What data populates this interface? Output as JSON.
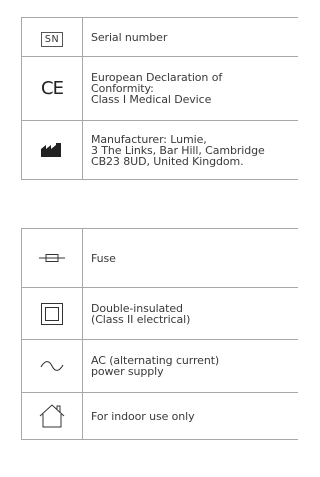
{
  "symbols_primary": [
    {
      "icon": "serial-number-sn-icon",
      "icon_text": "SN",
      "lines": [
        "Serial number"
      ]
    },
    {
      "icon": "ce-mark-icon",
      "icon_text": "CE",
      "lines": [
        "European Declaration of",
        "Conformity:",
        "Class I Medical Device"
      ]
    },
    {
      "icon": "manufacturer-factory-icon",
      "lines": [
        "Manufacturer: Lumie,",
        "3 The Links, Bar Hill, Cambridge",
        "CB23 8UD, United Kingdom."
      ]
    }
  ],
  "symbols_secondary": [
    {
      "icon": "fuse-icon",
      "lines": [
        "Fuse"
      ]
    },
    {
      "icon": "double-insulated-square-icon",
      "lines": [
        "Double-insulated",
        "(Class II electrical)"
      ]
    },
    {
      "icon": "ac-sine-wave-icon",
      "lines": [
        "AC (alternating current)",
        "power supply"
      ]
    },
    {
      "icon": "indoor-house-icon",
      "lines": [
        "For indoor use only"
      ]
    }
  ]
}
